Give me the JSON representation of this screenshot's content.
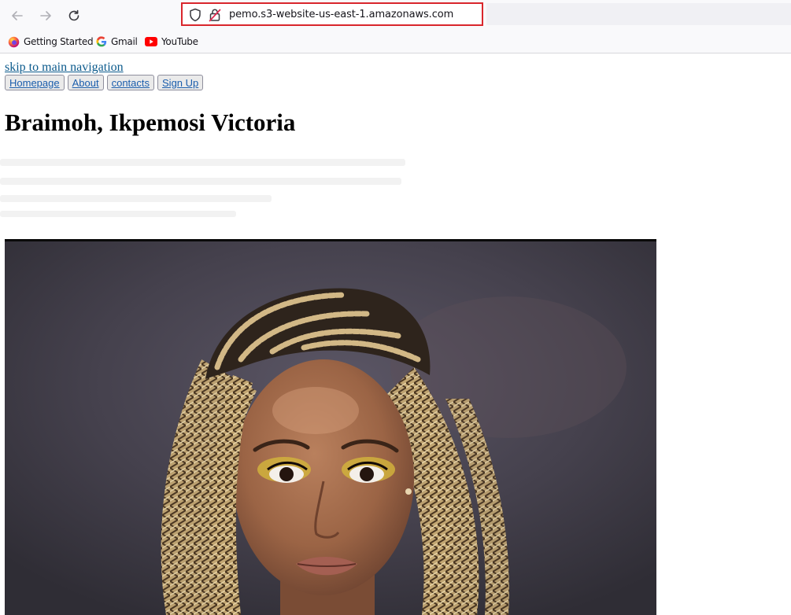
{
  "browser": {
    "url": "pemo.s3-website-us-east-1.amazonaws.com",
    "bookmarks": [
      {
        "label": "Getting Started",
        "icon": "firefox-icon"
      },
      {
        "label": "Gmail",
        "icon": "google-icon"
      },
      {
        "label": "YouTube",
        "icon": "youtube-icon"
      }
    ],
    "highlight_color": "#d9262c"
  },
  "page": {
    "skip_link": "skip to main navigation",
    "nav": [
      "Homepage",
      "About",
      "contacts",
      "Sign Up"
    ],
    "title": "Braimoh, Ikpemosi Victoria"
  }
}
